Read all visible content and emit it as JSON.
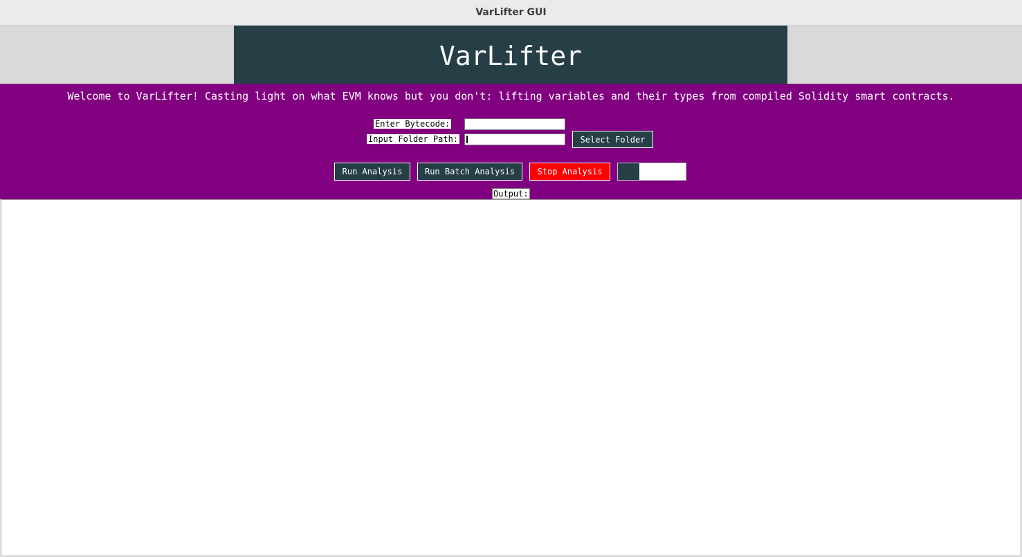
{
  "window": {
    "title": "VarLifter GUI"
  },
  "header": {
    "logo_text": "VarLifter"
  },
  "welcome_text": "Welcome to VarLifter! Casting light on what EVM knows but you don't: lifting variables and their types from compiled Solidity smart contracts.",
  "form": {
    "bytecode_label": "Enter Bytecode:",
    "bytecode_value": "",
    "folder_label": "Input Folder Path:",
    "folder_value": "",
    "select_folder_label": "Select Folder"
  },
  "actions": {
    "run_label": "Run Analysis",
    "batch_label": "Run Batch Analysis",
    "stop_label": "Stop Analysis"
  },
  "progress": {
    "fraction": 0.32
  },
  "output": {
    "label": "Output:",
    "content": ""
  },
  "colors": {
    "accent_dark": "#263f47",
    "purple_band": "#800080",
    "stop_red": "#ff0000"
  }
}
